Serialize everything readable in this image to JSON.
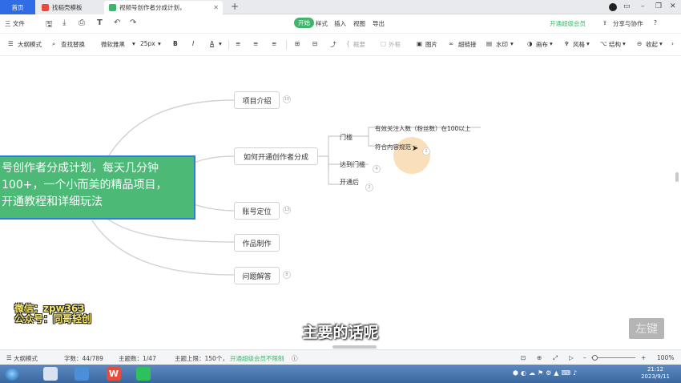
{
  "tabs": {
    "home": "首页",
    "template": "找稻壳模板",
    "doc": "视频号创作者分成计划，"
  },
  "menu": {
    "file": "三 文件",
    "start": "开始",
    "style": "样式",
    "insert": "插入",
    "view": "视图",
    "export": "导出",
    "vip": "开通超级会员",
    "share": "分享与协作",
    "help": "?"
  },
  "toolbar": {
    "outline": "大纲模式",
    "find": "查找替换",
    "font": "微软雅黑",
    "size": "25px",
    "bold": "B",
    "italic": "I",
    "color": "A",
    "summary": "概要",
    "frame": "外框",
    "image": "图片",
    "link": "超链接",
    "watermark": "水印",
    "canvas": "画布",
    "theme": "风格",
    "structure": "结构",
    "collapse": "收起"
  },
  "mindmap": {
    "central": [
      "号创作者分成计划，每天几分钟",
      "100+，一个小而美的精品项目，",
      "开通教程和详细玩法"
    ],
    "branches": [
      {
        "label": "项目介绍",
        "count": "10"
      },
      {
        "label": "如何开通创作者分成",
        "count": ""
      },
      {
        "label": "账号定位",
        "count": "13"
      },
      {
        "label": "作品制作",
        "count": ""
      },
      {
        "label": "问题解答",
        "count": "8"
      }
    ],
    "sub": {
      "threshold": "门槛",
      "reach": "达到门槛",
      "reach_count": "4",
      "after": "开通后",
      "after_count": "2",
      "cond1": "有效关注人数（粉丝数）在100以上",
      "cond2": "符合内容规范",
      "cond2_count": "2"
    }
  },
  "overlay": {
    "wechat": "微信：zpw363",
    "public": "公众号：同哥轻创",
    "subtitle": "主要的话呢",
    "leftkey": "左键"
  },
  "status": {
    "outline": "大纲模式",
    "words": "字数：44/789",
    "topics": "主题数：1/47",
    "limit": "主题上限：150个，",
    "vip_free": "开通超级会员不限制",
    "zoom": "100%"
  },
  "clock": {
    "time": "21:12",
    "date": "2023/9/11"
  }
}
